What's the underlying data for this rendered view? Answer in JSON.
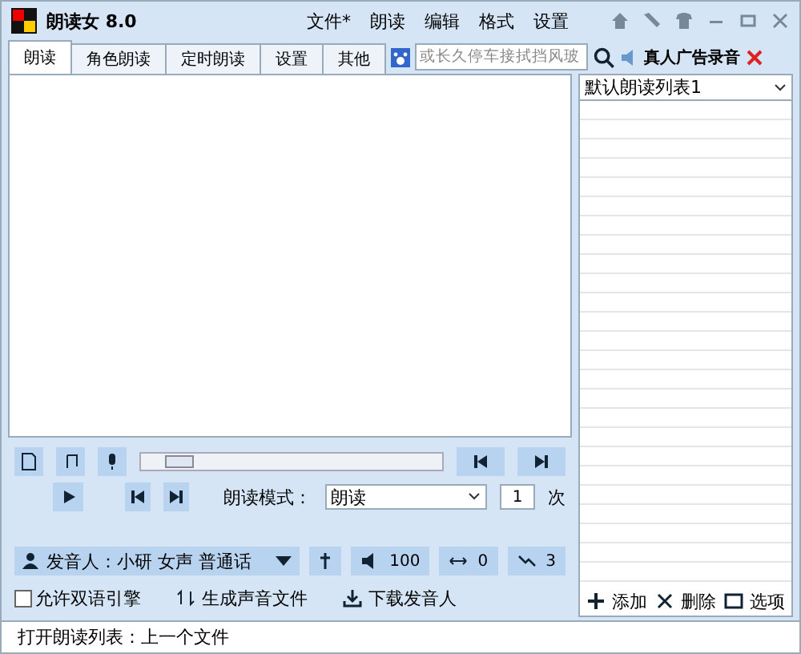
{
  "window": {
    "title": "朗读女 8.0"
  },
  "menu": [
    "文件*",
    "朗读",
    "编辑",
    "格式",
    "设置"
  ],
  "tabs": [
    {
      "label": "朗读",
      "selected": true
    },
    {
      "label": "角色朗读",
      "selected": false
    },
    {
      "label": "定时朗读",
      "selected": false
    },
    {
      "label": "设置",
      "selected": false
    },
    {
      "label": "其他",
      "selected": false
    }
  ],
  "search": {
    "placeholder": "或长久停车接拭挡风玻"
  },
  "ad_button": "真人广告录音",
  "playlist": {
    "selected_list": "默认朗读列表1",
    "buttons": [
      "添加",
      "删除",
      "选项"
    ]
  },
  "player": {
    "position": {
      "level": 0.08
    },
    "mode_label": "朗读模式：",
    "mode": "朗读",
    "repeat": "1",
    "repeat_unit": "次"
  },
  "voice": {
    "speaker": "发音人：小研 女声 普通话",
    "volume": "100",
    "speed": "0",
    "pitch": "3"
  },
  "bilingual": {
    "label": "允许双语引擎",
    "checked": false
  },
  "actions": [
    "生成声音文件",
    "下载发音人"
  ],
  "status_bar": "打开朗读列表：上一个文件"
}
